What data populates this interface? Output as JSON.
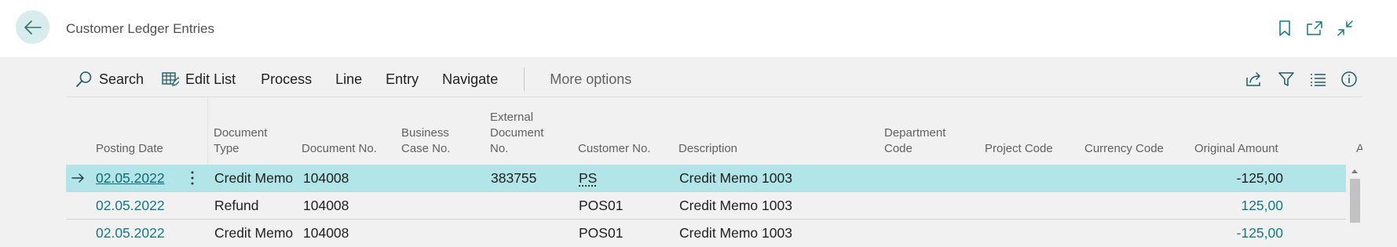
{
  "header": {
    "title": "Customer Ledger Entries",
    "icons": [
      "bookmark-icon",
      "open-new-window-icon",
      "collapse-icon"
    ]
  },
  "actions": {
    "search": "Search",
    "edit_list": "Edit List",
    "process": "Process",
    "line": "Line",
    "entry": "Entry",
    "navigate": "Navigate",
    "more_options": "More options",
    "right_icons": [
      "share-icon",
      "filter-icon",
      "list-view-icon",
      "info-icon"
    ]
  },
  "columns": {
    "posting_date": "Posting Date",
    "document_type": "Document\nType",
    "document_no": "Document No.",
    "business_case_no": "Business\nCase No.",
    "external_document_no": "External\nDocument\nNo.",
    "customer_no": "Customer No.",
    "description": "Description",
    "department_code": "Department\nCode",
    "project_code": "Project Code",
    "currency_code": "Currency Code",
    "original_amount": "Original Amount",
    "next_partial": "A"
  },
  "rows": [
    {
      "selected": true,
      "posting_date": "02.05.2022",
      "document_type": "Credit Memo",
      "document_no": "104008",
      "external_document_no": "383755",
      "customer_no": "PS",
      "description": "Credit Memo 1003",
      "original_amount": "-125,00"
    },
    {
      "selected": false,
      "posting_date": "02.05.2022",
      "document_type": "Refund",
      "document_no": "104008",
      "external_document_no": "",
      "customer_no": "POS01",
      "description": "Credit Memo 1003",
      "original_amount": "125,00"
    },
    {
      "selected": false,
      "posting_date": "02.05.2022",
      "document_type": "Credit Memo",
      "document_no": "104008",
      "external_document_no": "",
      "customer_no": "POS01",
      "description": "Credit Memo 1003",
      "original_amount": "-125,00"
    }
  ],
  "colors": {
    "accent": "#0f7b83",
    "selected_row": "#b1e5e8",
    "back_button": "#d6eced"
  }
}
